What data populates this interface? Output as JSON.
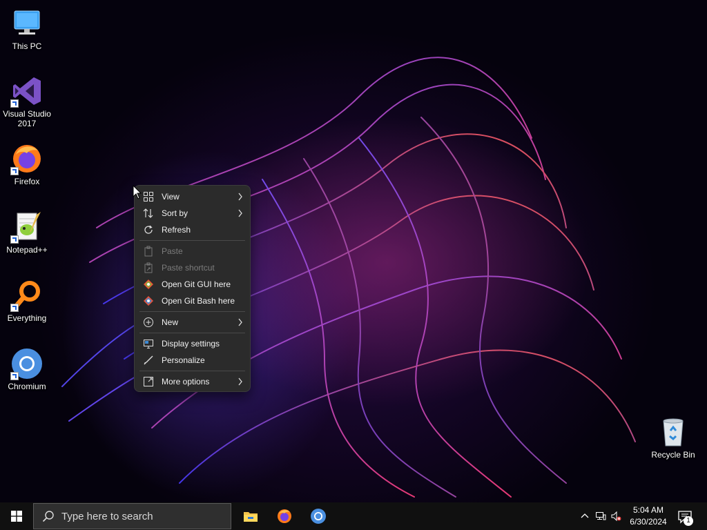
{
  "desktop": {
    "icons": [
      {
        "label": "This PC",
        "icon": "computer-icon"
      },
      {
        "label": "Visual Studio 2017",
        "icon": "visual-studio-icon"
      },
      {
        "label": "Firefox",
        "icon": "firefox-icon"
      },
      {
        "label": "Notepad++",
        "icon": "notepad-plus-plus-icon"
      },
      {
        "label": "Everything",
        "icon": "everything-search-icon"
      },
      {
        "label": "Chromium",
        "icon": "chromium-icon"
      },
      {
        "label": "Recycle Bin",
        "icon": "recycle-bin-icon"
      }
    ]
  },
  "context_menu": {
    "items": [
      {
        "label": "View",
        "icon": "grid-view-icon",
        "submenu": true,
        "enabled": true
      },
      {
        "label": "Sort by",
        "icon": "sort-icon",
        "submenu": true,
        "enabled": true
      },
      {
        "label": "Refresh",
        "icon": "refresh-icon",
        "submenu": false,
        "enabled": true
      },
      {
        "label": "Paste",
        "icon": "paste-icon",
        "submenu": false,
        "enabled": false
      },
      {
        "label": "Paste shortcut",
        "icon": "paste-shortcut-icon",
        "submenu": false,
        "enabled": false
      },
      {
        "label": "Open Git GUI here",
        "icon": "git-gui-icon",
        "submenu": false,
        "enabled": true
      },
      {
        "label": "Open Git Bash here",
        "icon": "git-bash-icon",
        "submenu": false,
        "enabled": true
      },
      {
        "label": "New",
        "icon": "new-plus-icon",
        "submenu": true,
        "enabled": true
      },
      {
        "label": "Display settings",
        "icon": "display-settings-icon",
        "submenu": false,
        "enabled": true
      },
      {
        "label": "Personalize",
        "icon": "personalize-brush-icon",
        "submenu": false,
        "enabled": true
      },
      {
        "label": "More options",
        "icon": "more-options-icon",
        "submenu": true,
        "enabled": true
      }
    ]
  },
  "taskbar": {
    "search_placeholder": "Type here to search",
    "pinned_apps": [
      {
        "name": "File Explorer",
        "icon": "file-explorer-icon"
      },
      {
        "name": "Firefox",
        "icon": "firefox-icon"
      },
      {
        "name": "Chromium",
        "icon": "chromium-icon"
      }
    ],
    "clock": {
      "time": "5:04 AM",
      "date": "6/30/2024"
    },
    "notification_count": "1"
  },
  "colors": {
    "menu_bg": "#2b2b2b",
    "menu_text": "#f2f2f2",
    "menu_disabled": "#7c7c7c",
    "taskbar_bg": "#101010",
    "search_bg": "#2f2f2f"
  }
}
